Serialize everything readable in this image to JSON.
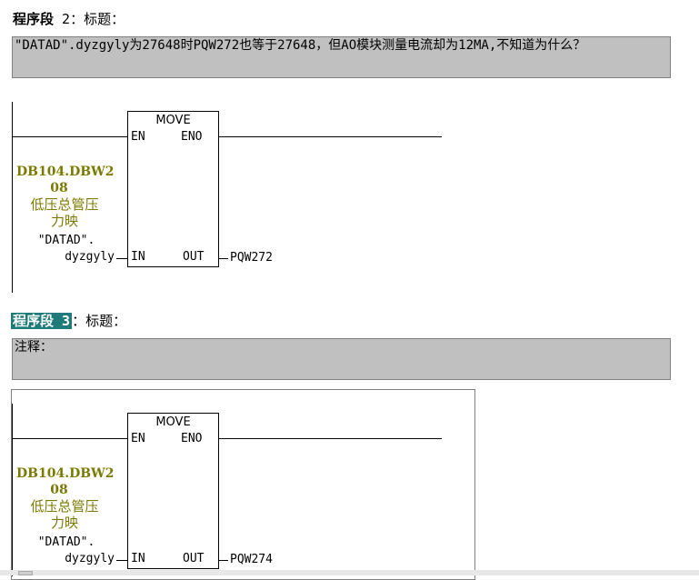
{
  "network2": {
    "label": "程序段",
    "number": " 2",
    "suffix": "：标题：",
    "comment": "\"DATAD\".dyzgyly为27648时PQW272也等于27648，但AO模块测量电流却为12MA,不知道为什么？",
    "block": {
      "name": "MOVE",
      "en": "EN",
      "eno": "ENO",
      "in": "IN",
      "out": "OUT",
      "in_address_line1": "DB104.DBW2",
      "in_address_line2": "08",
      "in_comment_line1": "低压总管压",
      "in_comment_line2": "力映",
      "in_symbol_line1": "\"DATAD\".",
      "in_symbol_line2": "dyzgyly",
      "out_operand": "PQW272"
    }
  },
  "network3": {
    "label": "程序段",
    "number": " 3",
    "suffix": "：标题：",
    "comment": "注释：",
    "block": {
      "name": "MOVE",
      "en": "EN",
      "eno": "ENO",
      "in": "IN",
      "out": "OUT",
      "in_address_line1": "DB104.DBW2",
      "in_address_line2": "08",
      "in_comment_line1": "低压总管压",
      "in_comment_line2": "力映",
      "in_symbol_line1": "\"DATAD\".",
      "in_symbol_line2": "dyzgyly",
      "out_operand": "PQW274"
    }
  },
  "colors": {
    "comment_bg": "#c0c0c0",
    "operand_address": "#7a7a00",
    "selection_highlight": "#1f7a7a"
  }
}
